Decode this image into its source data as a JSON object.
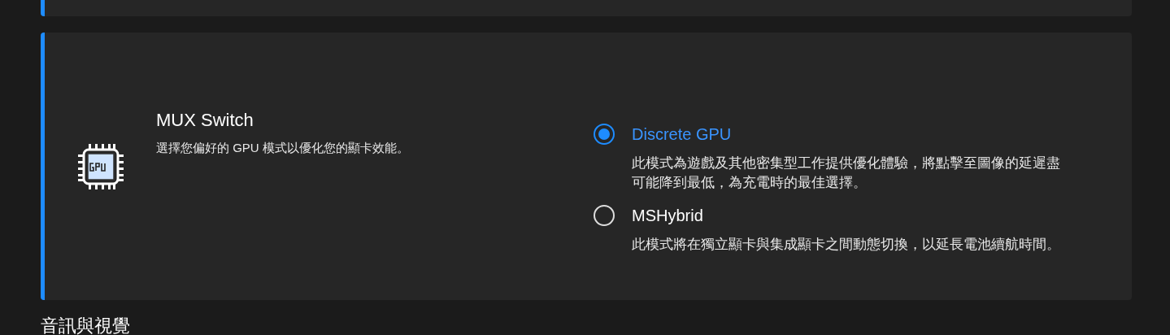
{
  "setting": {
    "title": "MUX Switch",
    "description": "選擇您偏好的 GPU 模式以優化您的顯卡效能。",
    "options": [
      {
        "label": "Discrete GPU",
        "description": "此模式為遊戲及其他密集型工作提供優化體驗，將點擊至圖像的延遲盡可能降到最低，為充電時的最佳選擇。",
        "selected": true
      },
      {
        "label": "MSHybrid",
        "description": "此模式將在獨立顯卡與集成顯卡之間動態切換，以延長電池續航時間。",
        "selected": false
      }
    ]
  },
  "section_heading": "音訊與視覺"
}
